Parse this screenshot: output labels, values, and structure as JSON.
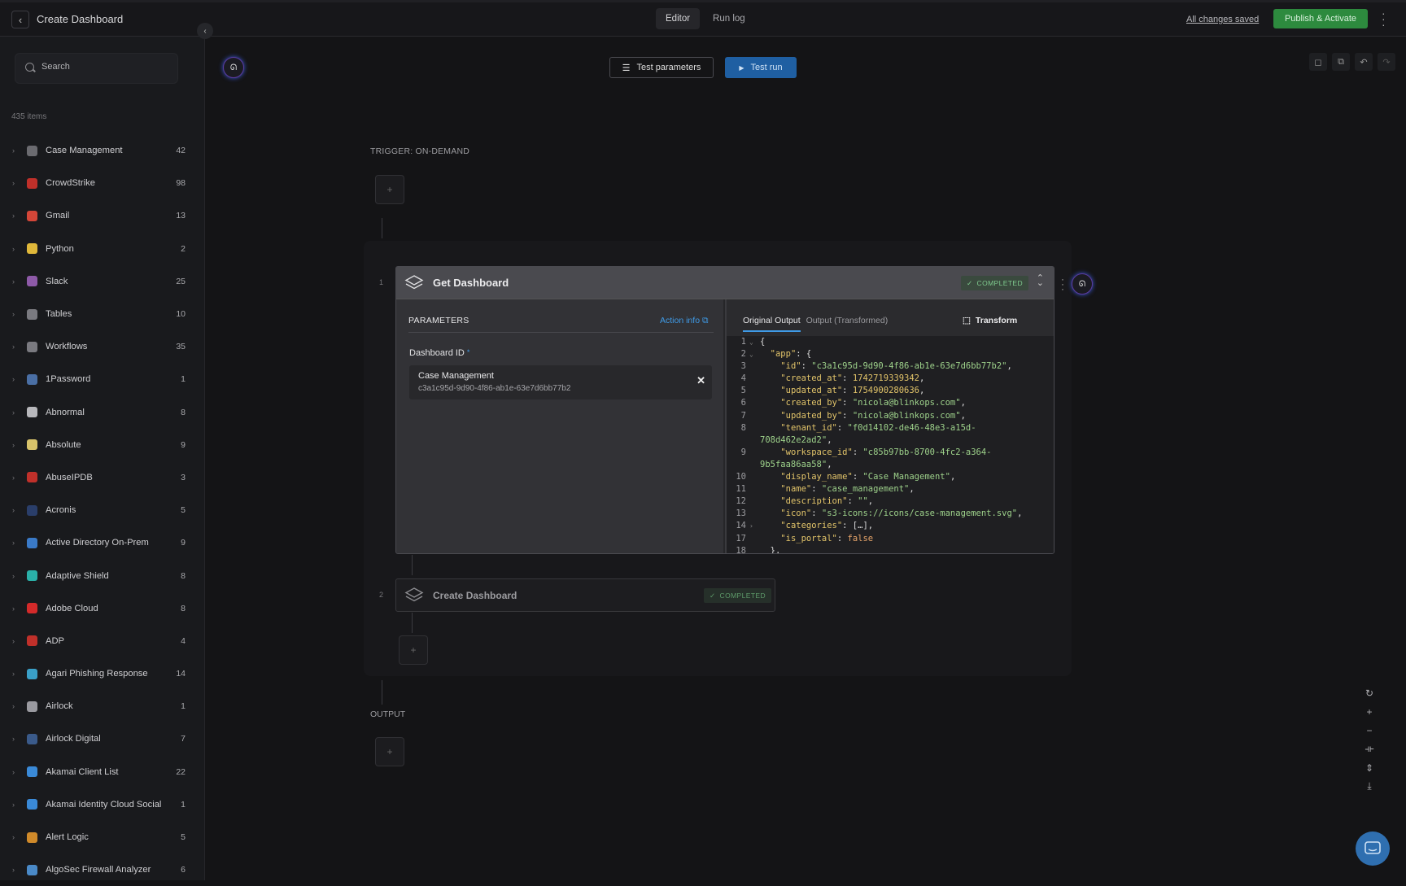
{
  "header": {
    "title": "Create Dashboard",
    "tabs": [
      {
        "label": "Editor"
      },
      {
        "label": "Run log"
      }
    ],
    "saved_status": "All changes saved",
    "publish_label": "Publish & Activate"
  },
  "sidebar": {
    "search_placeholder": "Search",
    "items_count": "435 items",
    "apps": [
      {
        "name": "Case Management",
        "count": "42",
        "color": "#6b6b70"
      },
      {
        "name": "CrowdStrike",
        "count": "98",
        "color": "#c0302a"
      },
      {
        "name": "Gmail",
        "count": "13",
        "color": "#d44638"
      },
      {
        "name": "Python",
        "count": "2",
        "color": "#e0b83a"
      },
      {
        "name": "Slack",
        "count": "25",
        "color": "#8e5aa8"
      },
      {
        "name": "Tables",
        "count": "10",
        "color": "#7a7a80"
      },
      {
        "name": "Workflows",
        "count": "35",
        "color": "#7a7a80"
      },
      {
        "name": "1Password",
        "count": "1",
        "color": "#4a6fa5"
      },
      {
        "name": "Abnormal",
        "count": "8",
        "color": "#b8b8bc"
      },
      {
        "name": "Absolute",
        "count": "9",
        "color": "#d8c36a"
      },
      {
        "name": "AbuseIPDB",
        "count": "3",
        "color": "#c0302a"
      },
      {
        "name": "Acronis",
        "count": "5",
        "color": "#2a3e6a"
      },
      {
        "name": "Active Directory On-Prem",
        "count": "9",
        "color": "#3a7ac8"
      },
      {
        "name": "Adaptive Shield",
        "count": "8",
        "color": "#2ab0a8"
      },
      {
        "name": "Adobe Cloud",
        "count": "8",
        "color": "#d42a2a"
      },
      {
        "name": "ADP",
        "count": "4",
        "color": "#c0302a"
      },
      {
        "name": "Agari Phishing Response",
        "count": "14",
        "color": "#3aa0c8"
      },
      {
        "name": "Airlock",
        "count": "1",
        "color": "#9a9aa0"
      },
      {
        "name": "Airlock Digital",
        "count": "7",
        "color": "#3a5a8a"
      },
      {
        "name": "Akamai Client List",
        "count": "22",
        "color": "#3a8ad8"
      },
      {
        "name": "Akamai Identity Cloud Social",
        "count": "1",
        "color": "#3a8ad8"
      },
      {
        "name": "Alert Logic",
        "count": "5",
        "color": "#d08a2a"
      },
      {
        "name": "AlgoSec Firewall Analyzer",
        "count": "6",
        "color": "#4a8ac8"
      }
    ]
  },
  "toolbar": {
    "test_params_label": "Test parameters",
    "test_run_label": "Test run"
  },
  "canvas": {
    "trigger_label": "TRIGGER: ON-DEMAND",
    "output_label": "OUTPUT",
    "step1": {
      "number": "1",
      "title": "Get Dashboard",
      "status": "COMPLETED",
      "params_title": "PARAMETERS",
      "action_info": "Action info",
      "field_label": "Dashboard ID",
      "field_value_name": "Case Management",
      "field_value_id": "c3a1c95d-9d90-4f86-ab1e-63e7d6bb77b2",
      "output_tabs": [
        "Original Output",
        "Output (Transformed)"
      ],
      "transform_label": "Transform",
      "code_lines": [
        {
          "n": "1",
          "fold": "v",
          "html": "{"
        },
        {
          "n": "2",
          "fold": "v",
          "html": "  <span class=\"k\">\"app\"</span>: {"
        },
        {
          "n": "3",
          "fold": "",
          "html": "    <span class=\"k\">\"id\"</span>: <span class=\"s\">\"c3a1c95d-9d90-4f86-ab1e-63e7d6bb77b2\"</span>,"
        },
        {
          "n": "4",
          "fold": "",
          "html": "    <span class=\"k\">\"created_at\"</span>: <span class=\"n\">1742719339342</span>,"
        },
        {
          "n": "5",
          "fold": "",
          "html": "    <span class=\"k\">\"updated_at\"</span>: <span class=\"n\">1754900280636</span>,"
        },
        {
          "n": "6",
          "fold": "",
          "html": "    <span class=\"k\">\"created_by\"</span>: <span class=\"s\">\"nicola@blinkops.com\"</span>,"
        },
        {
          "n": "7",
          "fold": "",
          "html": "    <span class=\"k\">\"updated_by\"</span>: <span class=\"s\">\"nicola@blinkops.com\"</span>,"
        },
        {
          "n": "8",
          "fold": "",
          "html": "    <span class=\"k\">\"tenant_id\"</span>: <span class=\"s\">\"f0d14102-de46-48e3-a15d-</span>"
        },
        {
          "n": "",
          "fold": "",
          "html": "<span class=\"s\">708d462e2ad2\"</span>,"
        },
        {
          "n": "9",
          "fold": "",
          "html": "    <span class=\"k\">\"workspace_id\"</span>: <span class=\"s\">\"c85b97bb-8700-4fc2-a364-</span>"
        },
        {
          "n": "",
          "fold": "",
          "html": "<span class=\"s\">9b5faa86aa58\"</span>,"
        },
        {
          "n": "10",
          "fold": "",
          "html": "    <span class=\"k\">\"display_name\"</span>: <span class=\"s\">\"Case Management\"</span>,"
        },
        {
          "n": "11",
          "fold": "",
          "html": "    <span class=\"k\">\"name\"</span>: <span class=\"s\">\"case_management\"</span>,"
        },
        {
          "n": "12",
          "fold": "",
          "html": "    <span class=\"k\">\"description\"</span>: <span class=\"s\">\"\"</span>,"
        },
        {
          "n": "13",
          "fold": "",
          "html": "    <span class=\"k\">\"icon\"</span>: <span class=\"s\">\"s3-icons://icons/case-management.svg\"</span>,"
        },
        {
          "n": "14",
          "fold": ">",
          "html": "    <span class=\"k\">\"categories\"</span>: […],"
        },
        {
          "n": "17",
          "fold": "",
          "html": "    <span class=\"k\">\"is_portal\"</span>: <span class=\"b\">false</span>"
        },
        {
          "n": "18",
          "fold": "",
          "html": "  },"
        }
      ]
    },
    "step2": {
      "number": "2",
      "title": "Create Dashboard",
      "status": "COMPLETED"
    }
  }
}
